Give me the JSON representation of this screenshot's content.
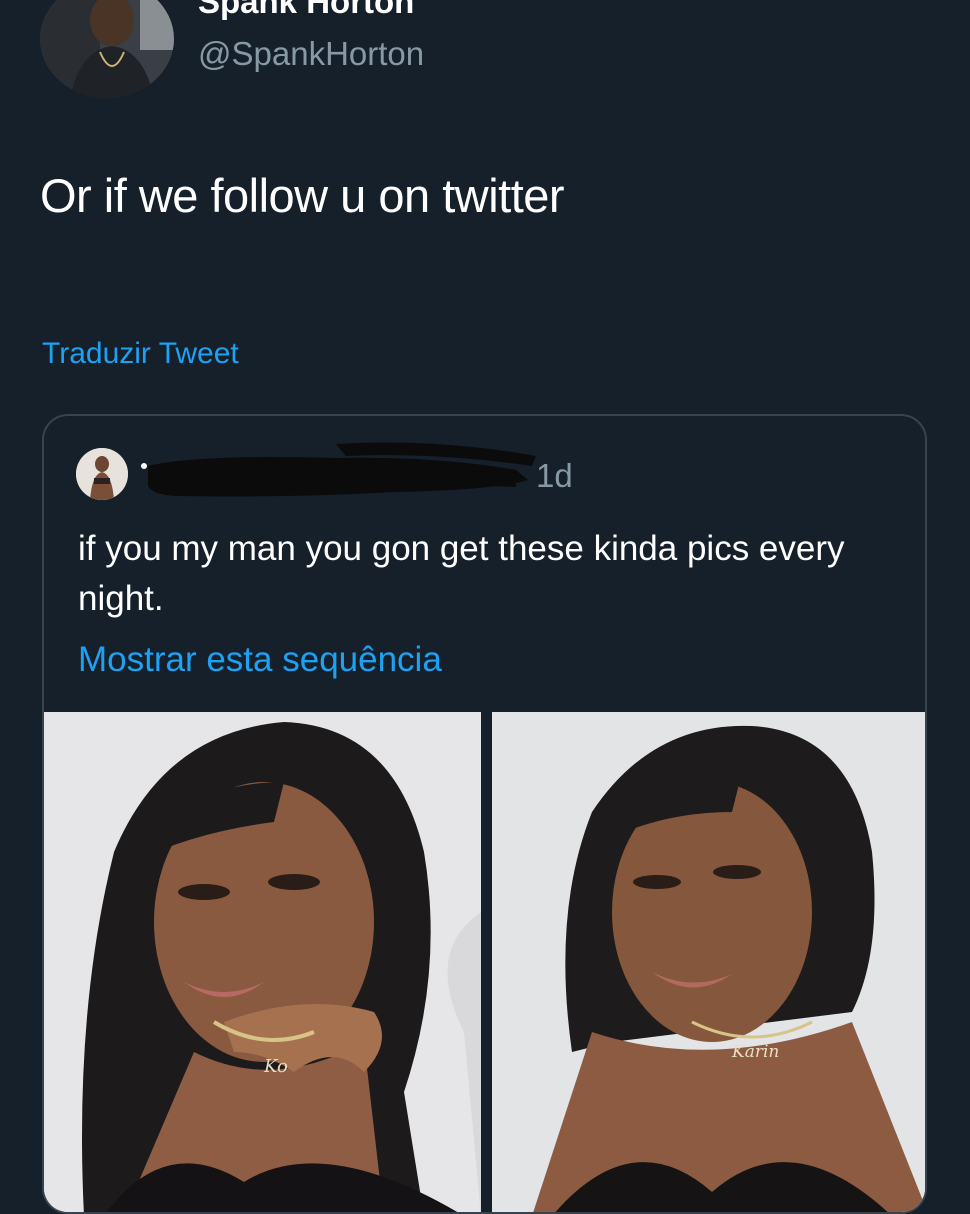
{
  "tweet": {
    "author": {
      "display_name": "Spank Horton",
      "handle": "@SpankHorton"
    },
    "text": "Or if we follow u on twitter",
    "translate_label": "Traduzir Tweet"
  },
  "quoted_tweet": {
    "time": "1d",
    "text": "if you my man you gon get these kinda pics every night.",
    "show_thread_label": "Mostrar esta sequência",
    "images": [
      {
        "necklace_text": "Ko"
      },
      {
        "necklace_text": "Karin"
      }
    ]
  },
  "colors": {
    "background": "#15202b",
    "primary_text": "#ffffff",
    "secondary_text": "#8899a6",
    "link": "#1da1f2",
    "border": "#38444d"
  }
}
